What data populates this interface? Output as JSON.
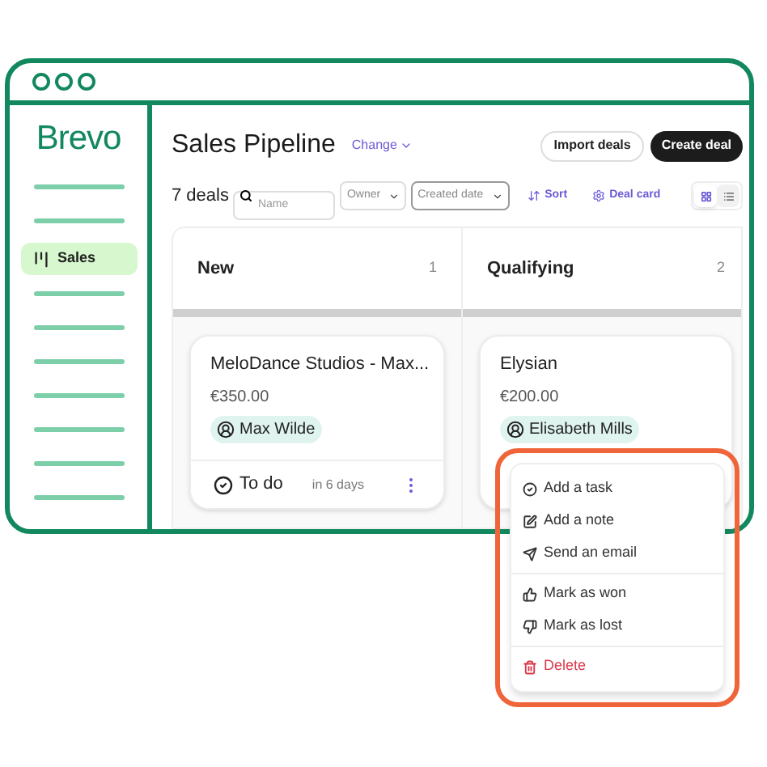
{
  "sidebar": {
    "logo": "Brevo",
    "items": [
      {
        "label": "Sales",
        "selected": true
      }
    ]
  },
  "header": {
    "title": "Sales Pipeline",
    "switcher": "Change",
    "buttons": [
      {
        "label": "Import deals",
        "kind": "secondary"
      },
      {
        "label": "Create deal",
        "kind": "primary"
      }
    ]
  },
  "toolbar": {
    "count": "7 deals",
    "search": {
      "placeholder": "Name"
    },
    "filters": [
      {
        "label": "Owner",
        "selected": false
      },
      {
        "label": "Created date",
        "selected": true
      }
    ],
    "sort": "Sort",
    "deal_card": "Deal card",
    "views": [
      {
        "selected": true
      },
      {
        "selected": false
      }
    ]
  },
  "columns": [
    {
      "name": "New",
      "count": "1",
      "cards": [
        {
          "title": "MeloDance Studios - Max...",
          "amount": "€350.00",
          "owner": "Max Wilde",
          "task": "To do",
          "due": "in 6 days"
        }
      ]
    },
    {
      "name": "Qualifying",
      "count": "2",
      "cards": [
        {
          "title": "Elysian",
          "amount": "€200.00",
          "owner": "Elisabeth Mills"
        }
      ]
    }
  ],
  "menu": {
    "groups": [
      [
        {
          "label": "Add a task",
          "kind": "normal"
        },
        {
          "label": "Add a note",
          "kind": "normal"
        },
        {
          "label": "Send an email",
          "kind": "normal"
        }
      ],
      [
        {
          "label": "Mark as won",
          "kind": "normal"
        },
        {
          "label": "Mark as lost",
          "kind": "normal"
        }
      ],
      [
        {
          "label": "Delete",
          "kind": "danger"
        }
      ]
    ]
  }
}
